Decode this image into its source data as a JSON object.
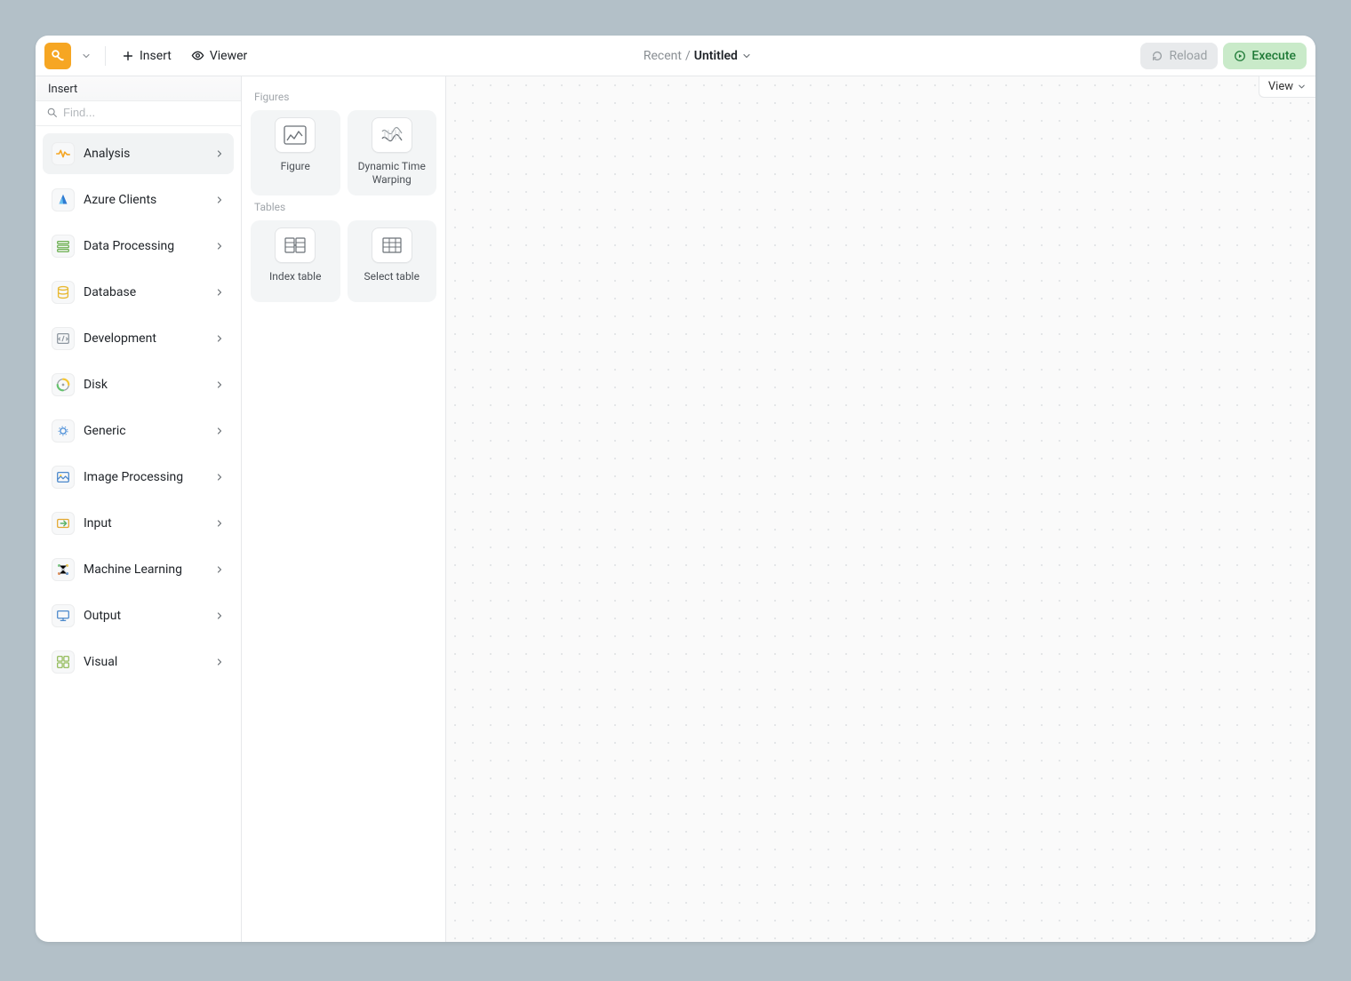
{
  "toolbar": {
    "insert_label": "Insert",
    "viewer_label": "Viewer",
    "breadcrumb_parent": "Recent",
    "breadcrumb_sep": "/",
    "breadcrumb_current": "Untitled",
    "reload_label": "Reload",
    "execute_label": "Execute"
  },
  "left_panel": {
    "title": "Insert",
    "search_placeholder": "Find...",
    "categories": [
      {
        "label": "Analysis",
        "active": true,
        "icon": "analysis"
      },
      {
        "label": "Azure Clients",
        "active": false,
        "icon": "azure"
      },
      {
        "label": "Data Processing",
        "active": false,
        "icon": "dataproc"
      },
      {
        "label": "Database",
        "active": false,
        "icon": "database"
      },
      {
        "label": "Development",
        "active": false,
        "icon": "dev"
      },
      {
        "label": "Disk",
        "active": false,
        "icon": "disk"
      },
      {
        "label": "Generic",
        "active": false,
        "icon": "generic"
      },
      {
        "label": "Image Processing",
        "active": false,
        "icon": "imageproc"
      },
      {
        "label": "Input",
        "active": false,
        "icon": "input"
      },
      {
        "label": "Machine Learning",
        "active": false,
        "icon": "ml"
      },
      {
        "label": "Output",
        "active": false,
        "icon": "output"
      },
      {
        "label": "Visual",
        "active": false,
        "icon": "visual"
      }
    ]
  },
  "mid_panel": {
    "sections": [
      {
        "label": "Figures",
        "cards": [
          {
            "label": "Figure",
            "icon": "figure"
          },
          {
            "label": "Dynamic Time Warping",
            "icon": "dtw"
          }
        ]
      },
      {
        "label": "Tables",
        "cards": [
          {
            "label": "Index table",
            "icon": "indextable"
          },
          {
            "label": "Select table",
            "icon": "selecttable"
          }
        ]
      }
    ]
  },
  "canvas": {
    "view_label": "View"
  }
}
